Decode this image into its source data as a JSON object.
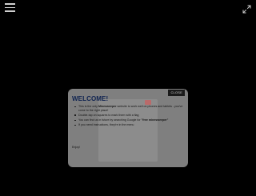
{
  "colors": {
    "background": "#000000",
    "dialog": "#7f7f7f",
    "title": "#0f2350",
    "close_button": "#1a1a1a"
  },
  "header": {
    "menu_icon": "hamburger-icon",
    "fullscreen_icon": "fullscreen-icon"
  },
  "welcome_dialog": {
    "close_label": "CLOSE",
    "title": "WELCOME!",
    "items": [
      {
        "before": "This is the only ",
        "bold": "Minesweeper",
        "after": " website to work well on phones and tablets - you've come to the right place!"
      },
      {
        "before": "Double-tap on squares to mark them with a flag",
        "bold": "",
        "after": ""
      },
      {
        "before": "You can find us in future by searching Google for ",
        "bold": "\"free minesweeper\"",
        "after": ""
      },
      {
        "before": "If you need instructions, they're in the menu",
        "bold": "",
        "after": ""
      }
    ],
    "signoff": "Enjoy!"
  }
}
